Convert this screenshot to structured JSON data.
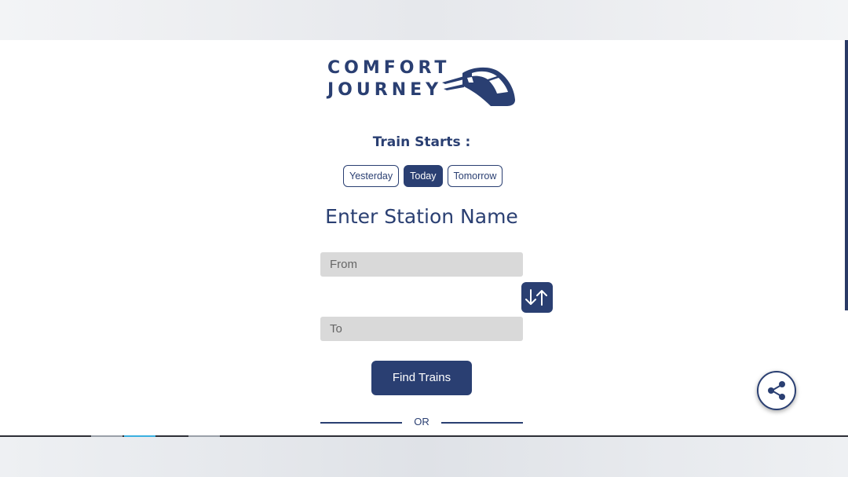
{
  "brand": {
    "line1": "COMFORT",
    "line2": "JOURNEY"
  },
  "train_starts": {
    "label": "Train Starts :",
    "options": [
      "Yesterday",
      "Today",
      "Tomorrow"
    ],
    "selected": "Today"
  },
  "station": {
    "heading": "Enter Station Name",
    "from_placeholder": "From",
    "to_placeholder": "To"
  },
  "actions": {
    "find_label": "Find Trains",
    "or_label": "OR"
  },
  "icons": {
    "swap": "swap-vertical-icon",
    "share": "share-icon",
    "logo": "train-icon"
  },
  "colors": {
    "brand": "#2a3f72",
    "input_bg": "#d9d9d9"
  }
}
